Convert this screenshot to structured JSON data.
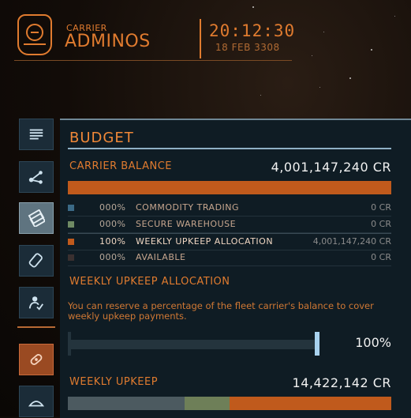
{
  "header": {
    "brand_small": "CARRIER",
    "brand_big": "ADMINOS",
    "clock": "20:12:30",
    "date": "18 FEB 3308"
  },
  "nav": {
    "items": [
      {
        "icon": "list-icon",
        "state": "normal"
      },
      {
        "icon": "route-icon",
        "state": "normal"
      },
      {
        "icon": "credits-icon",
        "state": "active"
      },
      {
        "icon": "tag-icon",
        "state": "normal"
      },
      {
        "icon": "crew-icon",
        "state": "normal"
      },
      {
        "icon": "repair-icon",
        "state": "orange"
      },
      {
        "icon": "carrier-icon",
        "state": "normal"
      }
    ]
  },
  "budget": {
    "title": "BUDGET",
    "balance_label": "CARRIER BALANCE",
    "balance_value": "4,001,147,240 CR",
    "balance_fill_fraction": 1.0,
    "allocations": [
      {
        "pct": "000%",
        "name": "COMMODITY TRADING",
        "amount": "0 CR",
        "color": "#3b6a86"
      },
      {
        "pct": "000%",
        "name": "SECURE WAREHOUSE",
        "amount": "0 CR",
        "color": "#6f8a64"
      },
      {
        "pct": "100%",
        "name": "WEEKLY UPKEEP ALLOCATION",
        "amount": "4,001,147,240 CR",
        "color": "#c05a1c"
      },
      {
        "pct": "000%",
        "name": "AVAILABLE",
        "amount": "0 CR",
        "color": "#3a3030"
      }
    ],
    "upkeep_alloc_label": "WEEKLY UPKEEP ALLOCATION",
    "upkeep_description": "You can reserve a percentage of the fleet carrier's balance to cover weekly upkeep payments.",
    "slider_percent": "100%",
    "slider_fraction": 1.0,
    "weekly_upkeep_label": "WEEKLY UPKEEP",
    "weekly_upkeep_value": "14,422,142 CR",
    "weekly_segments": [
      {
        "fraction": 0.36,
        "color": "#4c5a60"
      },
      {
        "fraction": 0.14,
        "color": "#6e7f58"
      },
      {
        "fraction": 0.5,
        "color": "#c05a1c"
      }
    ]
  },
  "colors": {
    "accent": "#e07b2f",
    "panel_bg": "#0f1c24",
    "highlight_blue": "#a8d2ee"
  }
}
